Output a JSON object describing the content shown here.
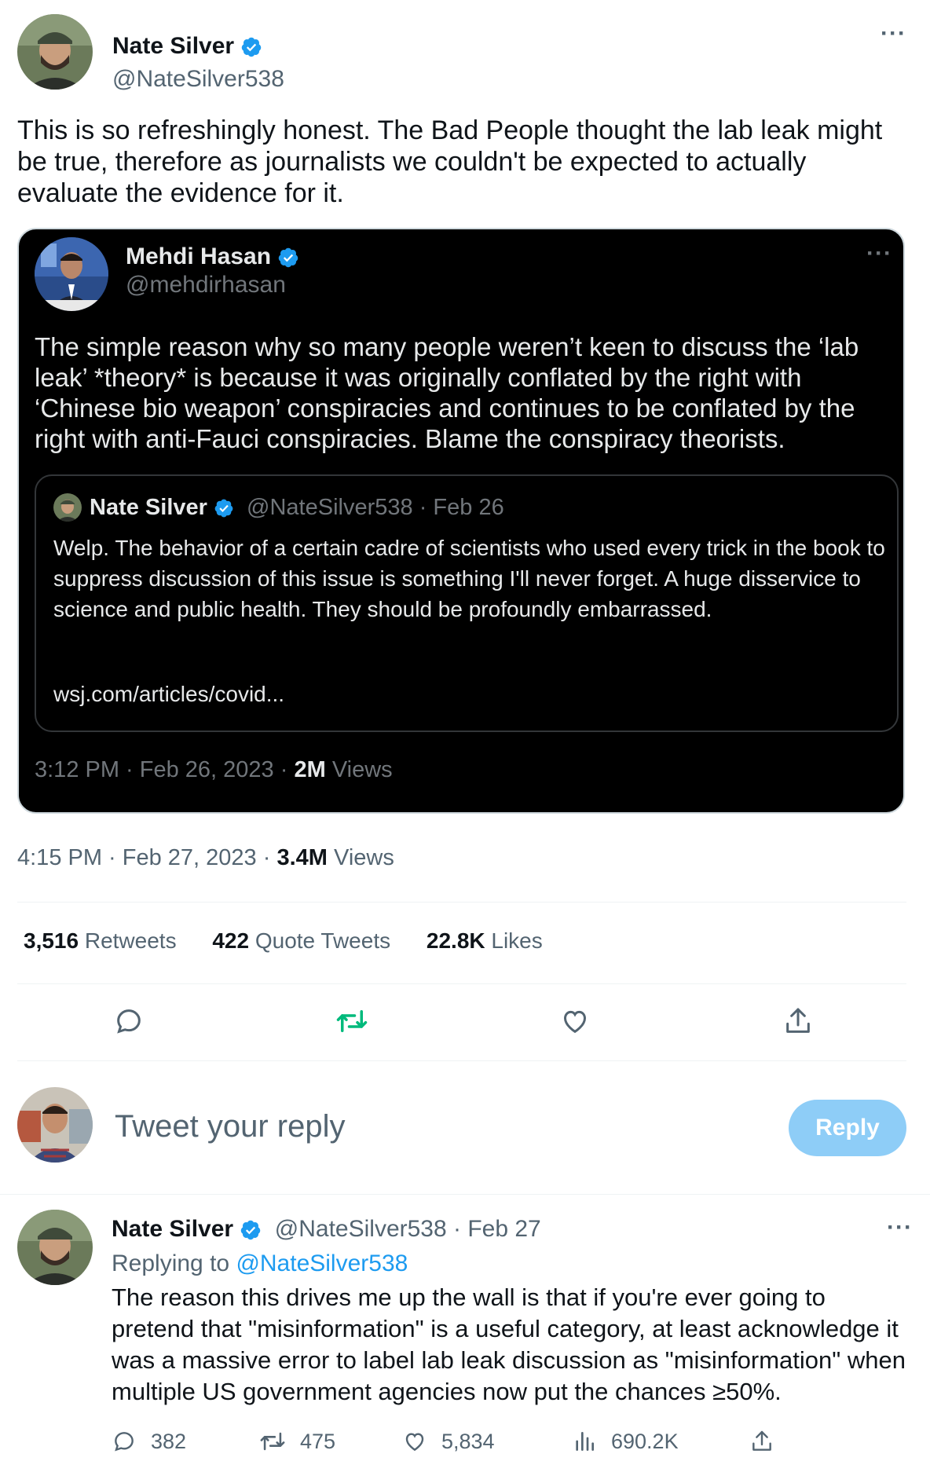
{
  "main_tweet": {
    "author": {
      "name": "Nate Silver",
      "handle": "@NateSilver538"
    },
    "more": "···",
    "text": "This is so refreshingly honest. The Bad People thought the lab leak might be true, therefore as journalists we couldn't be expected to actually evaluate the evidence for it.",
    "time": "4:15 PM · Feb 27, 2023 · ",
    "views_count": "3.4M",
    "views_label": " Views",
    "stats": {
      "retweets_count": "3,516",
      "retweets_label": " Retweets",
      "quotes_count": "422",
      "quotes_label": " Quote Tweets",
      "likes_count": "22.8K",
      "likes_label": " Likes"
    }
  },
  "quoted_tweet": {
    "author": {
      "name": "Mehdi Hasan",
      "handle": "@mehdirhasan"
    },
    "more": "···",
    "text": "The simple reason why so many people weren’t keen to discuss the ‘lab leak’ *theory* is because it was originally conflated by the right with ‘Chinese bio weapon’ conspiracies and continues to be conflated by the right with anti-Fauci conspiracies. Blame the conspiracy theorists.",
    "time": "3:12 PM · Feb 26, 2023 · ",
    "views_count": "2M",
    "views_label": " Views",
    "inner": {
      "name": "Nate Silver",
      "meta": "@NateSilver538 · Feb 26",
      "text": "Welp. The behavior of a certain cadre of scientists who used every trick in the book to suppress discussion of this issue is something I'll never forget. A huge disservice to science and public health. They should be profoundly embarrassed.",
      "link": "wsj.com/articles/covid..."
    }
  },
  "reply_box": {
    "placeholder": "Tweet your reply",
    "button": "Reply"
  },
  "reply_tweet": {
    "name": "Nate Silver",
    "meta": "@NateSilver538 · Feb 27",
    "more": "···",
    "replying_prefix": "Replying to ",
    "replying_to": "@NateSilver538",
    "text": "The reason this drives me up the wall is that if you're ever going to pretend that \"misinformation\" is a useful category, at least acknowledge it was a massive error to label lab leak discussion as \"misinformation\" when multiple US government agencies now put the chances ≥50%.",
    "actions": {
      "replies": "382",
      "retweets": "475",
      "likes": "5,834",
      "views": "690.2K"
    }
  },
  "colors": {
    "verified": "#1d9bf0",
    "retweet_green": "#00ba7c",
    "reply_button": "#8ecdf7",
    "text_primary": "#0f1419",
    "text_secondary": "#536471"
  },
  "icons": [
    "verified-badge-icon",
    "more-options-icon",
    "reply-icon",
    "retweet-icon",
    "like-icon",
    "share-icon",
    "views-icon"
  ]
}
